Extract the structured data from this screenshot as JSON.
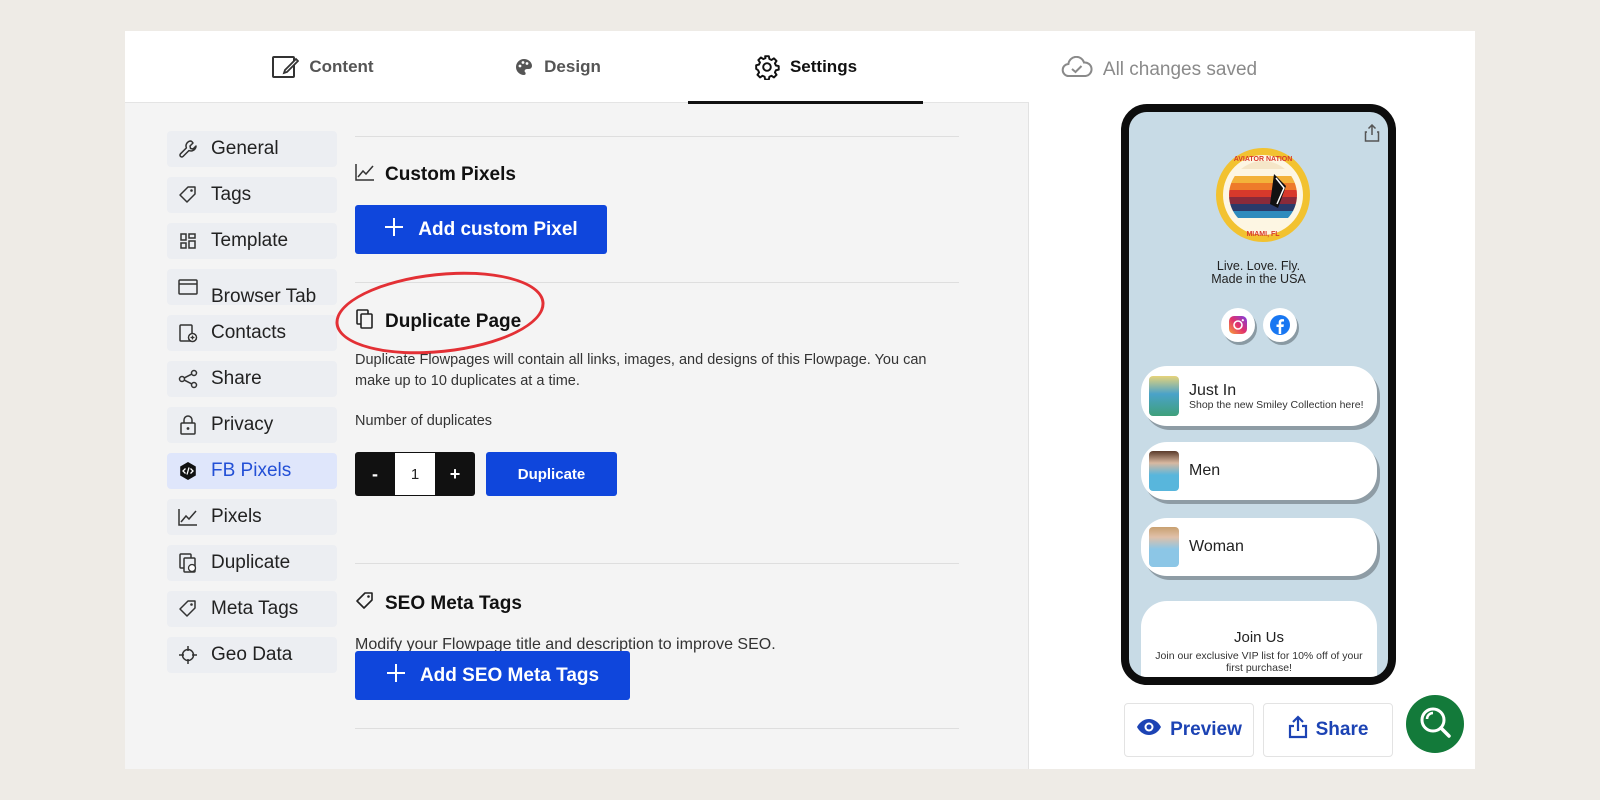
{
  "tabs": [
    {
      "label": "Content"
    },
    {
      "label": "Design"
    },
    {
      "label": "Settings"
    }
  ],
  "active_tab": "Settings",
  "sidebar": {
    "items": [
      {
        "label": "General",
        "icon": "wrench-icon"
      },
      {
        "label": "Tags",
        "icon": "tag-icon"
      },
      {
        "label": "Template",
        "icon": "template-icon"
      },
      {
        "label": "Browser Tab",
        "icon": "browser-icon"
      },
      {
        "label": "Contacts",
        "icon": "contacts-icon"
      },
      {
        "label": "Share",
        "icon": "share-icon"
      },
      {
        "label": "Privacy",
        "icon": "lock-icon"
      },
      {
        "label": "FB Pixels",
        "icon": "code-badge-icon"
      },
      {
        "label": "Pixels",
        "icon": "chart-icon"
      },
      {
        "label": "Duplicate",
        "icon": "duplicate-icon"
      },
      {
        "label": "Meta Tags",
        "icon": "tag-icon"
      },
      {
        "label": "Geo Data",
        "icon": "crosshair-icon"
      }
    ],
    "active": "FB Pixels"
  },
  "custom_pixels": {
    "title": "Custom Pixels",
    "button": "Add custom Pixel"
  },
  "duplicate": {
    "title": "Duplicate Page",
    "description": "Duplicate Flowpages will contain all links, images, and designs of this Flowpage. You can make up to 10 duplicates at a time.",
    "number_label": "Number of duplicates",
    "minus": "-",
    "value": "1",
    "plus": "+",
    "button": "Duplicate"
  },
  "seo": {
    "title": "SEO Meta Tags",
    "description": "Modify your Flowpage title and description to improve SEO.",
    "button": "Add SEO Meta Tags"
  },
  "status": "All changes saved",
  "phone": {
    "tagline_1": "Live. Love. Fly.",
    "tagline_2": "Made in the USA",
    "logo_text_top": "AVIATOR NATION",
    "logo_text_bottom": "MIAMI, FL",
    "links": [
      {
        "title": "Just In",
        "subtitle": "Shop the new Smiley Collection here!"
      },
      {
        "title": "Men",
        "subtitle": ""
      },
      {
        "title": "Woman",
        "subtitle": ""
      }
    ],
    "join": {
      "title": "Join Us",
      "subtitle": "Join our exclusive VIP list for 10% off of your first purchase!"
    }
  },
  "preview_button": "Preview",
  "share_button": "Share",
  "colors": {
    "primary": "#0f46dc",
    "active_nav_bg": "#dfe6fb",
    "annotation": "#e33035",
    "phone_bg": "#c8dbe6",
    "help_fab": "#137a3a"
  }
}
